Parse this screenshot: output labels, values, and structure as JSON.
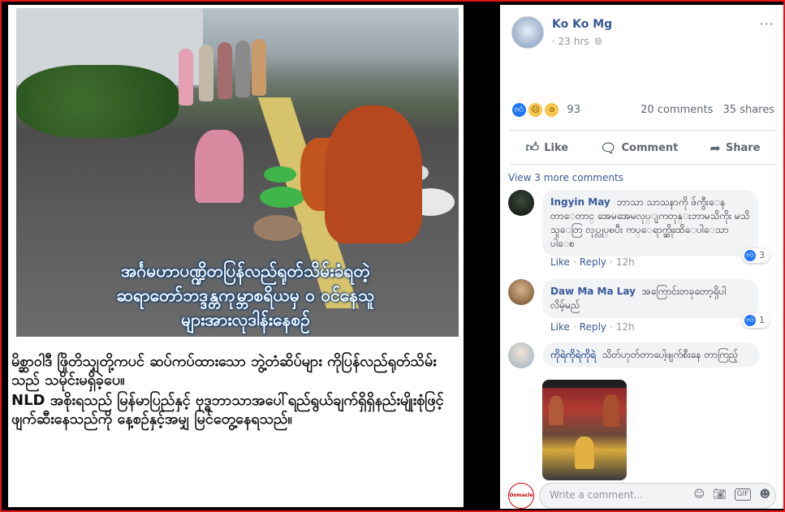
{
  "left_panel": {
    "photo_caption_lines": [
      "အင်္ဂမဟာပဏ္ဍိတပြန်လည်ရုတ်သိမ်းခံရတဲ့",
      "ဆရာတော်ဘဒ္ဒန္တကုမ္ဘာစရိယမှ ဝ ဝင်နေသူ",
      "များအားလုဒါန်းနေစဥ်"
    ],
    "body_paragraphs": [
      "မိစ္ဆာဝါဒီ ဖြိုတိသျှတို့ကပင် ဆပ်ကပ်ထားသော ဘွဲ့တံဆိပ်များ ကိုပြန်လည်ရုတ်သိမ်းသည် သမိုင်းမရှိခဲ့ပေ။",
      "NLD အစိုးရသည် မြန်မာပြည်နှင့် ဗုဒ္ဓဘာသာအပေါ်ရည်ရွယ်ချက်ရှိရှိနည်းမျိုးစုံဖြင့် ဖျက်ဆီးနေသည်ကို နေ့စဥ်နှင့်အမျှ မြင်တွေ့နေရသည်။"
    ]
  },
  "post": {
    "author": "Ko Ko Mg",
    "time": "23 hrs",
    "privacy_icon": "globe-icon",
    "more_label": "···",
    "reaction_count": "93",
    "comments_label": "20 comments",
    "shares_label": "35 shares",
    "actions": {
      "like": "Like",
      "comment": "Comment",
      "share": "Share"
    }
  },
  "comments_section": {
    "view_more": "View 3 more comments",
    "comments": [
      {
        "name": "Ingyin May",
        "text": "ဘာသာ သာသနာကို ဖ်ကွီးေန တာေတာင္ အေမအေမလုပ္ျကတုန္းဘာမသိကိုး မသိသူေတြ လုပ္လုပ္ၿပီး ကပ္ေရာက္ဆိုးထိေပါေသာ ပါေစ",
        "like": "Like",
        "reply": "Reply",
        "time": "12h",
        "reaction_count": "3"
      },
      {
        "name": "Daw Ma Ma Lay",
        "text": "အကြောင်းတခုတော့ရှိပါ လိမ့်မည်",
        "like": "Like",
        "reply": "Reply",
        "time": "12h",
        "reaction_count": "1"
      },
      {
        "name": "ကိုရဲကိုရဲကိုရဲ",
        "text": "သိတ်ဟုတ်တာပေါ့ဖျက်စီးနေ တာကြည့်",
        "like": "",
        "reply": "",
        "time": ""
      }
    ]
  },
  "composer": {
    "placeholder": "Write a comment...",
    "avatar_text": "Oomacle Secondo"
  }
}
